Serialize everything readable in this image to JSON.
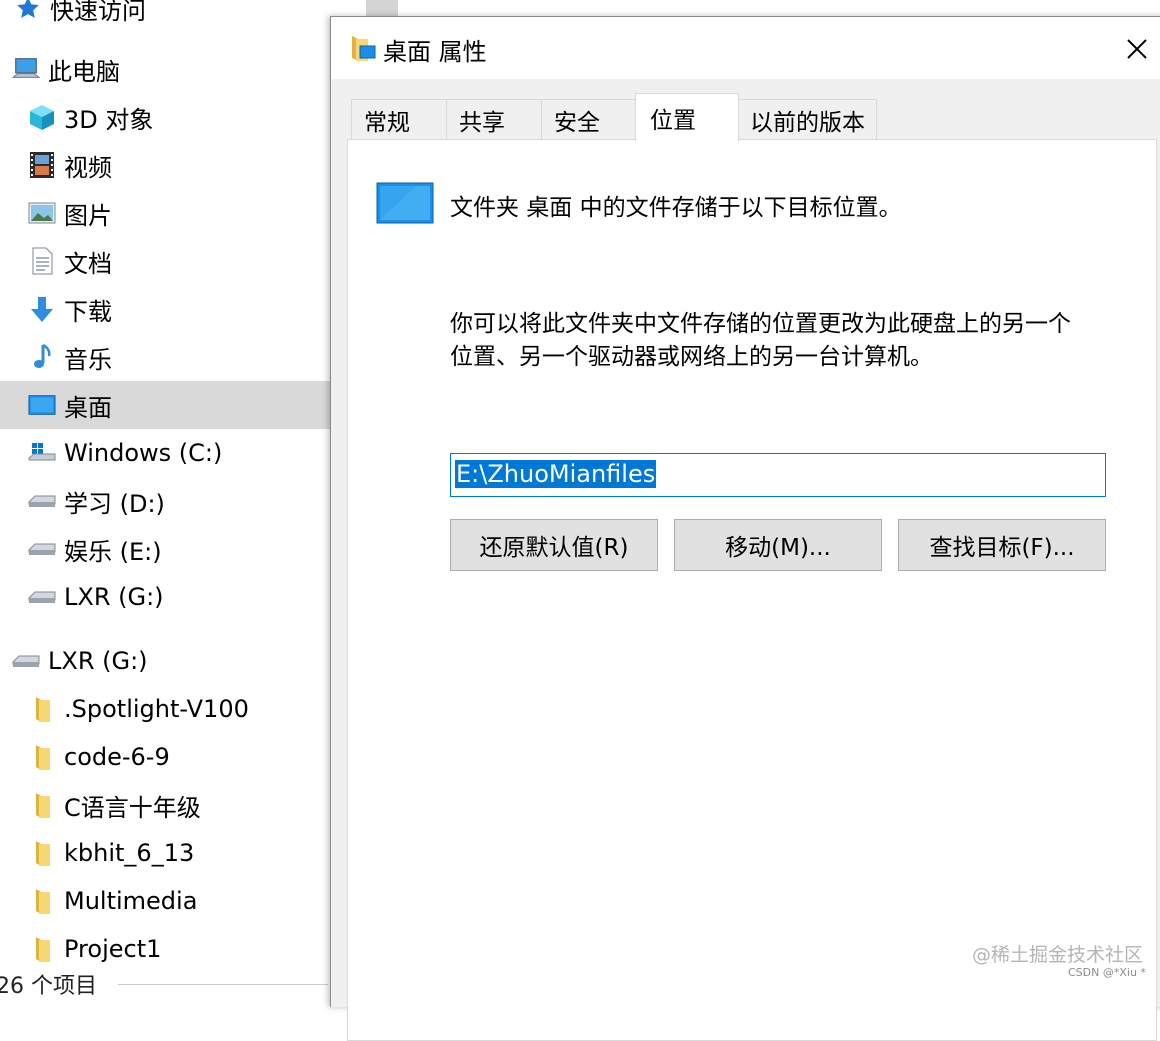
{
  "nav": {
    "quick_access": "快速访问",
    "this_pc": "此电脑",
    "objects_3d": "3D 对象",
    "videos": "视频",
    "pictures": "图片",
    "documents": "文档",
    "downloads": "下载",
    "music": "音乐",
    "desktop": "桌面",
    "drive_c": "Windows (C:)",
    "drive_d": "学习 (D:)",
    "drive_e": "娱乐 (E:)",
    "drive_g": "LXR (G:)",
    "drive_g_root": "LXR (G:)",
    "folders": [
      ".Spotlight-V100",
      "code-6-9",
      "C语言十年级",
      "kbhit_6_13",
      "Multimedia",
      "Project1"
    ]
  },
  "status_bar": "26 个项目",
  "dialog": {
    "title": "桌面 属性",
    "tabs": [
      "常规",
      "共享",
      "安全",
      "位置",
      "以前的版本"
    ],
    "active_tab": "位置",
    "location_text": "文件夹 桌面 中的文件存储于以下目标位置。",
    "description_line1": "你可以将此文件夹中文件存储的位置更改为此硬盘上的另一个",
    "description_line2": "位置、另一个驱动器或网络上的另一台计算机。",
    "path_value": "E:\\ZhuoMianfiles",
    "restore_default_label": "还原默认值(R)",
    "move_label": "移动(M)...",
    "find_target_label": "查找目标(F)..."
  },
  "watermark": {
    "site": "@稀土掘金技术社区",
    "author": "CSDN @*Xiu *"
  },
  "colors": {
    "selection": "#0078d7",
    "nav_selected": "#d9d9d9",
    "dialog_bg": "#f0f0f0",
    "folder_yellow": "#f8d775",
    "desktop_blue": "#1a8fe8"
  }
}
